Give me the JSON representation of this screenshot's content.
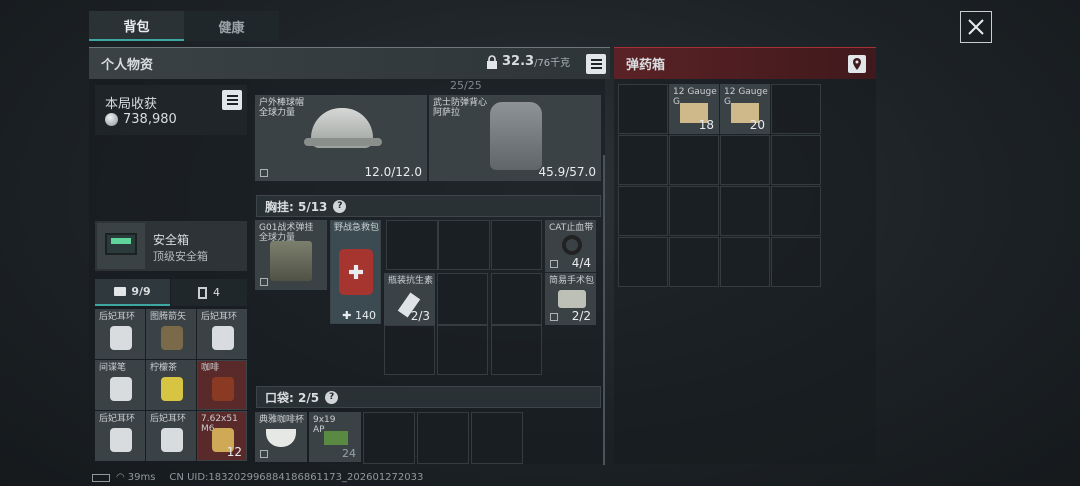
{
  "tabs": {
    "backpack": "背包",
    "health": "健康"
  },
  "personal": {
    "title": "个人物资",
    "weight": "32.3",
    "weight_max": "/76千克"
  },
  "ammo_box": {
    "title": "弹药箱"
  },
  "earnings": {
    "label": "本局收获",
    "value": "738,980"
  },
  "safe_box": {
    "name": "安全箱",
    "type": "顶级安全箱"
  },
  "inv_tabs": {
    "items": "9/9",
    "keys": "4"
  },
  "scroll_label": "25/25",
  "gear": [
    {
      "name": "户外棒球帽\n全球力量",
      "count": "12.0/12.0"
    },
    {
      "name": "武士防弹背心\n阿萨拉",
      "count": "45.9/57.0"
    }
  ],
  "chest": {
    "label": "胸挂: 5/13",
    "items": [
      {
        "name": "G01战术弹挂\n全球力量"
      },
      {
        "name": "野战急救包",
        "count": "140"
      },
      {
        "name": "CAT止血带",
        "count": "4/4"
      },
      {
        "name": "瓶装抗生素",
        "count": "2/3"
      },
      {
        "name": "简易手术包",
        "count": "2/2"
      }
    ]
  },
  "pocket": {
    "label": "口袋: 2/5",
    "items": [
      {
        "name": "典雅咖啡杯"
      },
      {
        "name": "9x19\nAP",
        "count": "24"
      }
    ]
  },
  "secure_items": [
    {
      "name": "后妃耳环"
    },
    {
      "name": "图腾箭矢"
    },
    {
      "name": "后妃耳环"
    },
    {
      "name": "间谍笔"
    },
    {
      "name": "柠檬茶"
    },
    {
      "name": "咖啡"
    },
    {
      "name": "后妃耳环"
    },
    {
      "name": "后妃耳环"
    },
    {
      "name": "7.62x51\nM6",
      "count": "12"
    }
  ],
  "ammo_items": [
    {
      "name": "12 Gauge\nG",
      "count": "18"
    },
    {
      "name": "12 Gauge\nG",
      "count": "20"
    }
  ],
  "status": {
    "ping": "39ms",
    "uid": "CN UID:183202996884186861173_202601272033"
  },
  "colors": {
    "accent": "#3fa7a1",
    "ammo_header": "#5a2226"
  }
}
